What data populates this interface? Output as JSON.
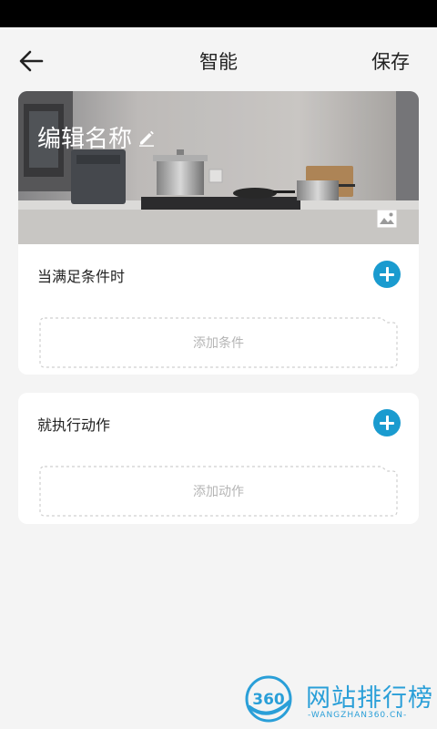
{
  "nav": {
    "back_icon": "arrow-left-icon",
    "title": "智能",
    "save_label": "保存"
  },
  "scene": {
    "name": "编辑名称",
    "edit_icon": "pencil-icon",
    "cover_icon": "image-icon"
  },
  "condition_section": {
    "label": "当满足条件时",
    "add_icon": "plus-circle-icon",
    "placeholder": "添加条件"
  },
  "action_section": {
    "label": "就执行动作",
    "add_icon": "plus-circle-icon",
    "placeholder": "添加动作"
  },
  "watermark": {
    "logo_text": "360",
    "title": "网站排行榜",
    "subtitle": "-WANGZHAN360.CN-"
  },
  "colors": {
    "accent": "#1a9bcf",
    "background": "#f4f4f4",
    "card": "#ffffff",
    "placeholder_text": "#b5b5b5",
    "watermark": "#2a9fd8"
  }
}
